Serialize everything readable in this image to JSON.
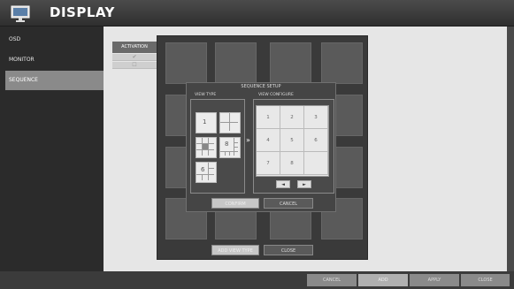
{
  "header": {
    "title": "DISPLAY",
    "icon": "monitor-icon"
  },
  "sidebar": {
    "items": [
      {
        "label": "OSD",
        "active": false
      },
      {
        "label": "MONITOR",
        "active": false
      },
      {
        "label": "SEQUENCE",
        "active": true
      }
    ]
  },
  "activation": {
    "header": "ACTIVATION",
    "rows": [
      "✔",
      "☐"
    ]
  },
  "dialog": {
    "title": "SEQUENCE SETUP",
    "view_type_label": "VIEW TYPE",
    "view_config_label": "VIEW CONFIGURE",
    "view_types": [
      {
        "label": "1"
      },
      {
        "label": ""
      },
      {
        "label": ""
      },
      {
        "label": "8"
      },
      {
        "label": "6"
      }
    ],
    "arrow": "»",
    "config_cells": [
      "1",
      "2",
      "3",
      "4",
      "5",
      "6",
      "7",
      "8",
      ""
    ],
    "prev": "◄",
    "next": "►",
    "confirm": "CONFIRM",
    "cancel": "CANCEL"
  },
  "thumb_panel": {
    "add_view_type": "ADD VIEW TYPE",
    "close": "CLOSE"
  },
  "footer": {
    "cancel": "CANCEL",
    "add": "ADD",
    "apply": "APPLY",
    "close": "CLOSE"
  }
}
